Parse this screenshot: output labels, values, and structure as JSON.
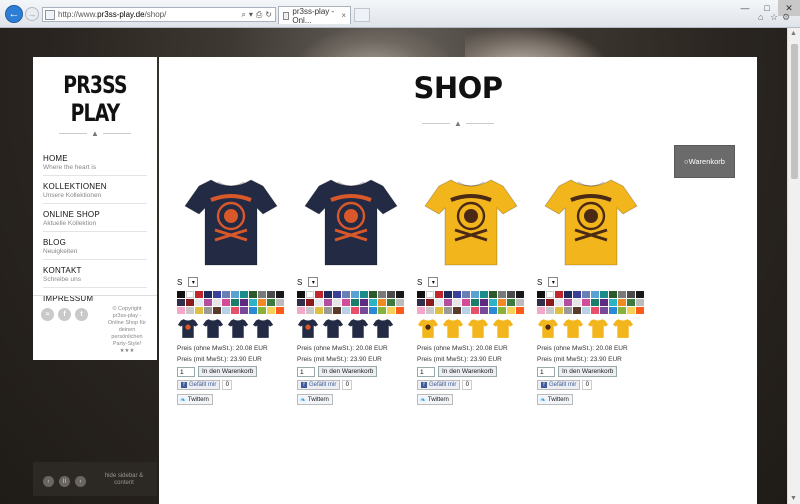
{
  "browser": {
    "url_scheme": "http://www.",
    "url_host": "pr3ss-play.de",
    "url_path": "/shop/",
    "tab_title": "pr3ss-play - Onl...",
    "tab_close": "×",
    "back_glyph": "←",
    "forward_glyph": "→",
    "win_min": "—",
    "win_max": "□",
    "win_close": "✕",
    "addr_tools": [
      "⌕",
      "▾",
      "⎙",
      "↻"
    ],
    "toolbar_icons": [
      "⌂",
      "☆",
      "⚙"
    ]
  },
  "sidebar": {
    "logo": "PR3SS PLAY",
    "logo_icon": "tshirt-icon",
    "menu": [
      {
        "title": "HOME",
        "subtitle": "Where the heart is"
      },
      {
        "title": "KOLLEKTIONEN",
        "subtitle": "Unsere Kollektionen"
      },
      {
        "title": "ONLINE SHOP",
        "subtitle": "Aktuelle Kollektion"
      },
      {
        "title": "BLOG",
        "subtitle": "Neuigkeiten"
      },
      {
        "title": "KONTAKT",
        "subtitle": "Schreibe uns"
      },
      {
        "title": "IMPRESSUM",
        "subtitle": ""
      }
    ],
    "social": [
      "rss-icon",
      "facebook-icon",
      "twitter-icon"
    ],
    "social_glyphs": [
      "≈",
      "f",
      "t"
    ],
    "copyright": "© Copyright pr3ss-play - Online Shop für deinen persönlichen Party-Style!",
    "stars": "★★★",
    "footer_text": "hide sidebar & content",
    "footer_controls": [
      "‹",
      "II",
      "›"
    ]
  },
  "main": {
    "title": "SHOP",
    "title_icon": "tshirt-icon",
    "cart_label": "Warenkorb",
    "cart_icon": "○"
  },
  "product_labels": {
    "size": "S",
    "size_arrow": "▾",
    "price_net": "Preis (ohne MwSt.): 20.08 EUR",
    "price_gross": "Preis (mit MwSt.): 23.90 EUR",
    "qty": "1",
    "add_to_cart": "In den Warenkorb",
    "like": "Gefällt mir",
    "like_count": "0",
    "tweet": "Twittern"
  },
  "products": [
    {
      "shirt_color": "#222a44",
      "print_color": "#d9582a"
    },
    {
      "shirt_color": "#222a44",
      "print_color": "#d9582a"
    },
    {
      "shirt_color": "#f3b51c",
      "print_color": "#4a2a14"
    },
    {
      "shirt_color": "#f3b51c",
      "print_color": "#4a2a14"
    }
  ],
  "swatch_colors": [
    "#111111",
    "#ffffff",
    "#c0272d",
    "#1c2a5e",
    "#3a3f9a",
    "#6a7fb6",
    "#5aa2d4",
    "#1e8b8b",
    "#2a5a2a",
    "#7a7a7a",
    "#4a4a4a",
    "#1a1a1a",
    "#2f2f4a",
    "#8b1a1a",
    "#e4eaf0",
    "#b44ea0",
    "#e6e6e6",
    "#d14c9a",
    "#1a7f6a",
    "#5e2a82",
    "#2bb3c8",
    "#f08a24",
    "#3d7a3d",
    "#bbbbbb",
    "#f6a6c8",
    "#c8c8c8",
    "#e0c040",
    "#9a9a9a",
    "#5a3a2a",
    "#b8d0e8",
    "#e8506a",
    "#7a4a9a",
    "#2a8ad4",
    "#8ab23a",
    "#f4d25a",
    "#ff5a1a"
  ],
  "thumb_variants": [
    "front",
    "back",
    "left",
    "right"
  ]
}
